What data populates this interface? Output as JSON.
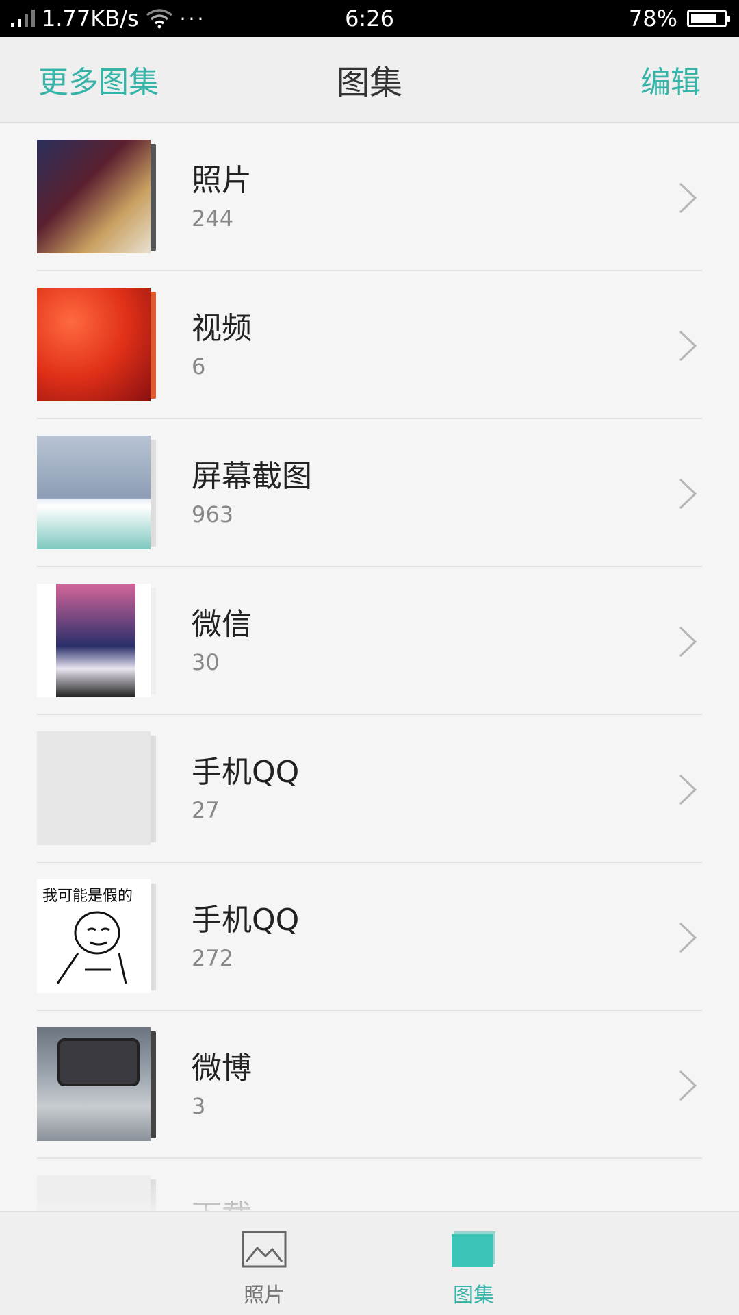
{
  "status_bar": {
    "net_speed": "1.77KB/s",
    "more": "···",
    "time": "6:26",
    "battery_percent": "78%",
    "battery_level": 0.78,
    "icons": [
      "signal-icon",
      "wifi-icon",
      "battery-icon"
    ]
  },
  "header": {
    "left_action": "更多图集",
    "title": "图集",
    "right_action": "编辑",
    "accent_color": "#36b4a8"
  },
  "albums": [
    {
      "name": "照片",
      "count": "244"
    },
    {
      "name": "视频",
      "count": "6"
    },
    {
      "name": "屏幕截图",
      "count": "963"
    },
    {
      "name": "微信",
      "count": "30"
    },
    {
      "name": "手机QQ",
      "count": "27"
    },
    {
      "name": "手机QQ",
      "count": "272"
    },
    {
      "name": "微博",
      "count": "3"
    },
    {
      "name": "下载",
      "count": ""
    }
  ],
  "thumbnail_texts": {
    "meme_caption": "我可能是假的"
  },
  "bottom_nav": {
    "tabs": [
      {
        "label": "照片",
        "icon": "image-icon",
        "active": false
      },
      {
        "label": "图集",
        "icon": "albums-icon",
        "active": true
      }
    ]
  }
}
